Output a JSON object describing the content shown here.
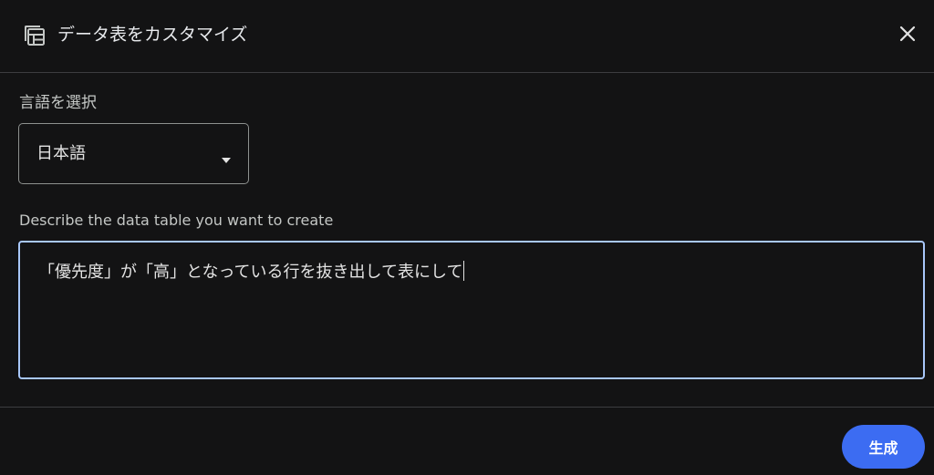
{
  "dialog": {
    "title": "データ表をカスタマイズ",
    "title_icon": "table-edit-icon",
    "close_icon": "close-icon"
  },
  "language": {
    "label": "言語を選択",
    "selected": "日本語",
    "arrow_icon": "dropdown-arrow-icon"
  },
  "prompt": {
    "label": "Describe the data table you want to create",
    "value": "「優先度」が「高」となっている行を抜き出して表にして"
  },
  "footer": {
    "generate_label": "生成"
  },
  "colors": {
    "background": "#131314",
    "divider": "#3c3d40",
    "focus_border": "#a8c7fa",
    "primary_button": "#3c6cf2"
  }
}
